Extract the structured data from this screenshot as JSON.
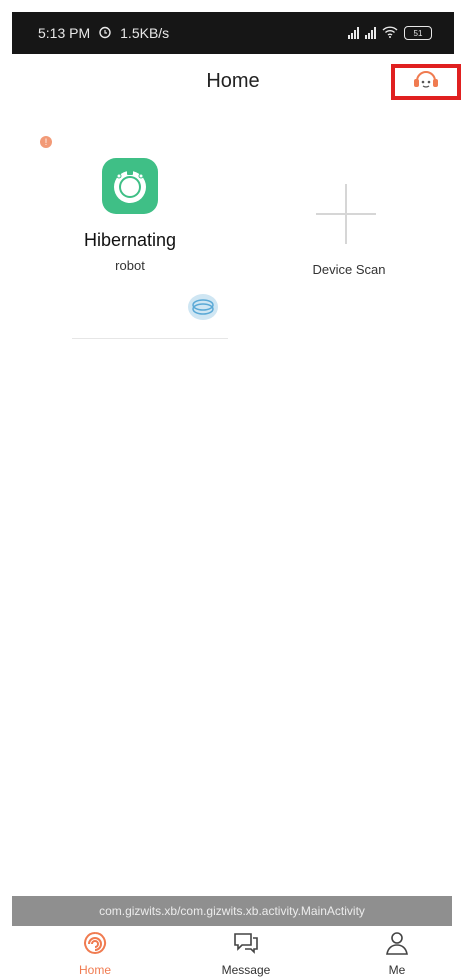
{
  "status_bar": {
    "time": "5:13 PM",
    "speed": "1.5KB/s",
    "battery": "51"
  },
  "header": {
    "title": "Home"
  },
  "devices": [
    {
      "status": "Hibernating",
      "name": "robot"
    }
  ],
  "add_device": {
    "label": "Device Scan"
  },
  "toast": {
    "text": "com.gizwits.xb/com.gizwits.xb.activity.MainActivity"
  },
  "nav": {
    "home": "Home",
    "message": "Message",
    "me": "Me"
  },
  "colors": {
    "accent": "#f07b50",
    "device_green": "#3fbf86",
    "highlight": "#e02020"
  },
  "icons": [
    "alarm-icon",
    "signal-icon",
    "wifi-icon",
    "battery-icon",
    "support-icon",
    "robot-vacuum-icon",
    "cleaning-icon",
    "plus-icon",
    "home-icon",
    "message-icon",
    "person-icon"
  ]
}
